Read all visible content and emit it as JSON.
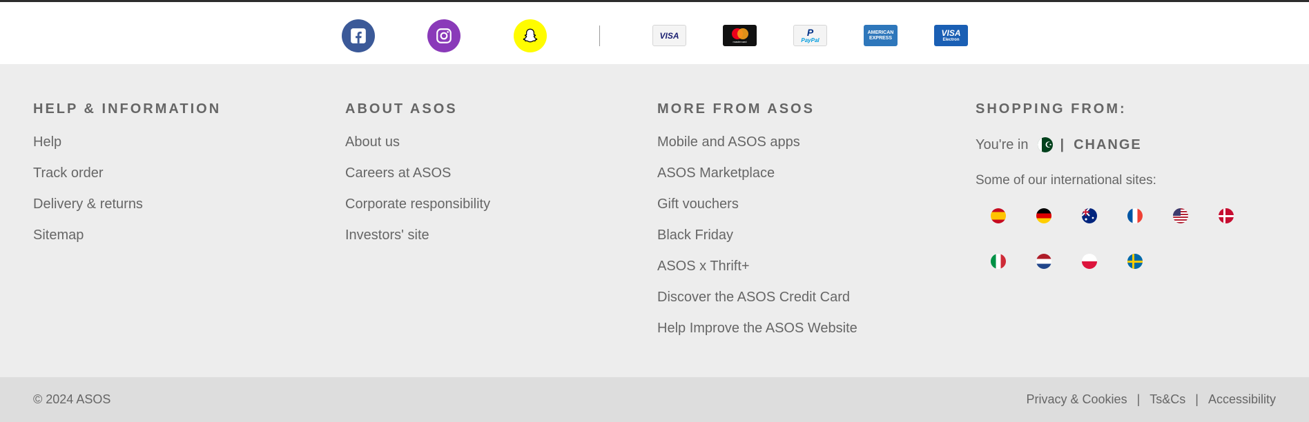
{
  "social": {
    "facebook": "Facebook",
    "instagram": "Instagram",
    "snapchat": "Snapchat",
    "colors": {
      "facebook": "#3b5998",
      "instagram": "#8a3ab9",
      "snapchat": "#fffc00"
    }
  },
  "payments": {
    "visa": "VISA",
    "mastercard": "mastercard",
    "paypal": "PayPal",
    "amex_1": "AMERICAN",
    "amex_2": "EXPRESS",
    "visa_electron_1": "VISA",
    "visa_electron_2": "Electron"
  },
  "columns": {
    "help": {
      "title": "HELP & INFORMATION",
      "links": [
        "Help",
        "Track order",
        "Delivery & returns",
        "Sitemap"
      ]
    },
    "about": {
      "title": "ABOUT ASOS",
      "links": [
        "About us",
        "Careers at ASOS",
        "Corporate responsibility",
        "Investors' site"
      ]
    },
    "more": {
      "title": "MORE FROM ASOS",
      "links": [
        "Mobile and ASOS apps",
        "ASOS Marketplace",
        "Gift vouchers",
        "Black Friday",
        "ASOS x Thrift+",
        "Discover the ASOS Credit Card",
        "Help Improve the ASOS Website"
      ]
    },
    "shopping": {
      "title": "SHOPPING FROM:",
      "youre_in": "You're in",
      "separator": "|",
      "change": "CHANGE",
      "intl_label": "Some of our international sites:"
    }
  },
  "flags": [
    "spain-flag-icon",
    "germany-flag-icon",
    "australia-flag-icon",
    "france-flag-icon",
    "usa-flag-icon",
    "denmark-flag-icon",
    "italy-flag-icon",
    "netherlands-flag-icon",
    "poland-flag-icon",
    "sweden-flag-icon"
  ],
  "footer": {
    "copyright": "© 2024 ASOS",
    "privacy": "Privacy & Cookies",
    "terms": "Ts&Cs",
    "accessibility": "Accessibility",
    "pipe": "|"
  }
}
